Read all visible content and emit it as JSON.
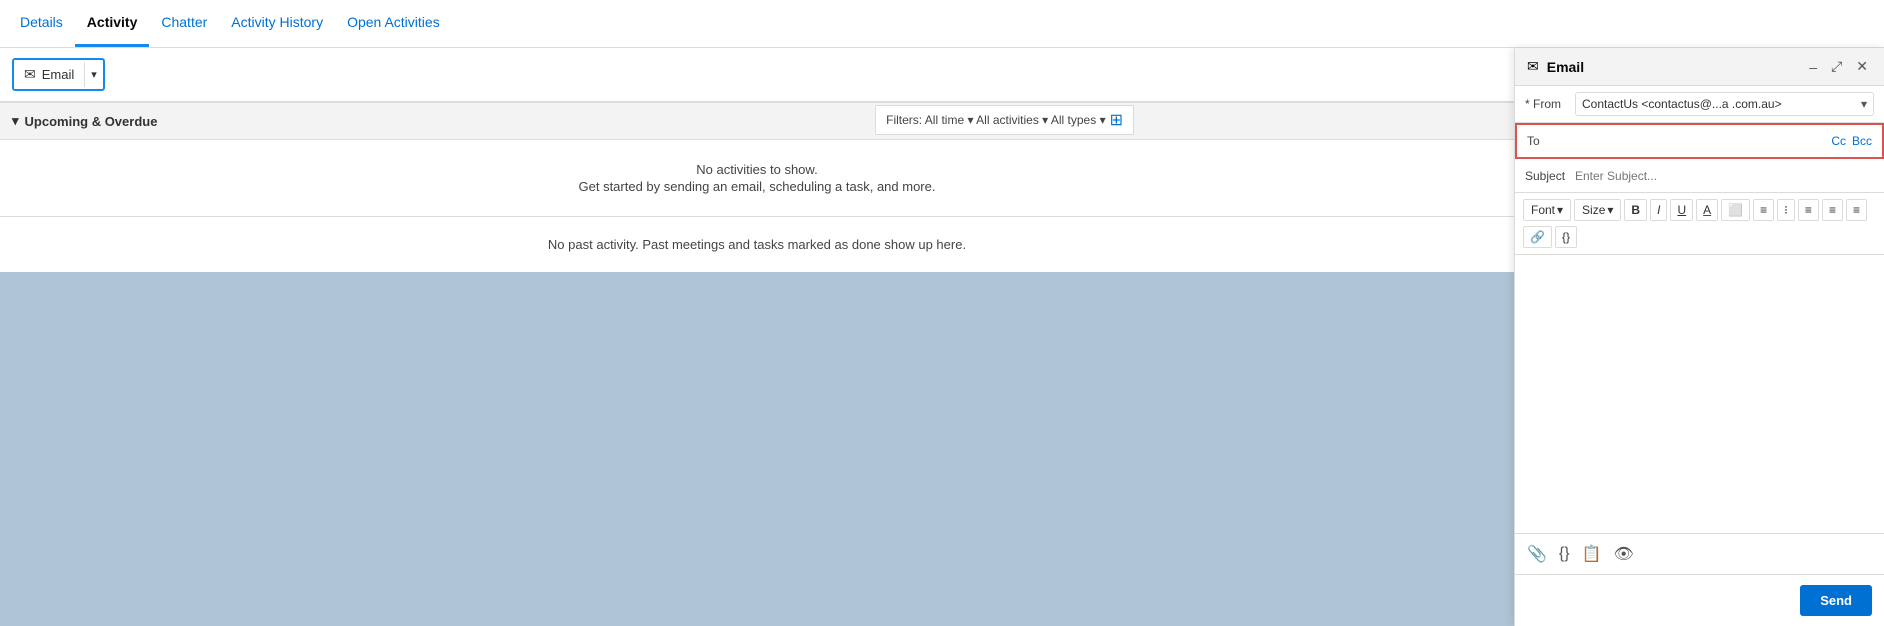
{
  "tabs": [
    {
      "id": "details",
      "label": "Details",
      "active": false
    },
    {
      "id": "activity",
      "label": "Activity",
      "active": true
    },
    {
      "id": "chatter",
      "label": "Chatter",
      "active": false
    },
    {
      "id": "activity-history",
      "label": "Activity History",
      "active": false
    },
    {
      "id": "open-activities",
      "label": "Open Activities",
      "active": false
    }
  ],
  "toolbar": {
    "email_button_label": "Email",
    "dropdown_arrow": "▾"
  },
  "upcoming": {
    "header_icon": "▾",
    "header_label": "Upcoming & Overdue",
    "no_activity_line1": "No activities to show.",
    "no_activity_line2": "Get started by sending an email, scheduling a task, and more.",
    "no_past_activity": "No past activity. Past meetings and tasks marked as done show up here."
  },
  "filters": {
    "label": "Filters: All time ▾ All activities ▾ All types ▾"
  },
  "email_panel": {
    "title": "Email",
    "minimize_icon": "–",
    "expand_icon": "⤢",
    "close_icon": "✕",
    "from_label": "* From",
    "from_value": "ContactUs <contactus@...a  .com.au>",
    "from_dropdown_arrow": "▾",
    "to_label": "To",
    "cc_label": "Cc",
    "bcc_label": "Bcc",
    "subject_label": "Subject",
    "subject_placeholder": "Enter Subject...",
    "font_label": "Font",
    "size_label": "Size",
    "bold_label": "B",
    "italic_label": "I",
    "underline_label": "U",
    "strikethrough_label": "A̲",
    "font_color_label": "A",
    "image_icon": "🖼",
    "ordered_list_icon": "≡",
    "unordered_list_icon": "⁝",
    "align_left_icon": "≡",
    "align_center_icon": "≡",
    "align_right_icon": "≡",
    "link_icon": "🔗",
    "code_icon": "{}",
    "template_icon": "📋",
    "visibility_icon": "👁",
    "attach_icon": "📎",
    "send_label": "Send",
    "dropdown_icon": "▾"
  }
}
